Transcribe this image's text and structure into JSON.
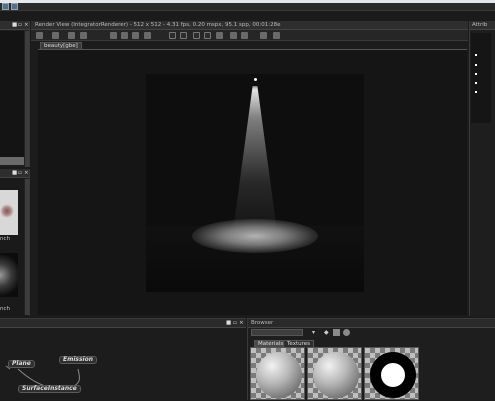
{
  "render_view": {
    "title": "Render View (IntegratorRenderer) - 512 x 512 - 4.31 fps,  0.20 mspx,  95.1 spp, 00:01:28e",
    "tab": "beauty[gbe]"
  },
  "left_panels": {
    "thumb_label_1": "nch",
    "thumb_label_2": "nch"
  },
  "right_panel": {
    "title": "Attrib"
  },
  "node_graph": {
    "nodes": {
      "plane": "Plane",
      "emission": "Emission",
      "surface_instance": "SurfaceInstance"
    }
  },
  "browser": {
    "title": "Browser",
    "tabs": [
      "Materials",
      "Textures"
    ]
  },
  "colors": {
    "accent_blue": "#5c6c8c",
    "panel_bg": "#141414",
    "chrome": "#2e2e2e"
  }
}
